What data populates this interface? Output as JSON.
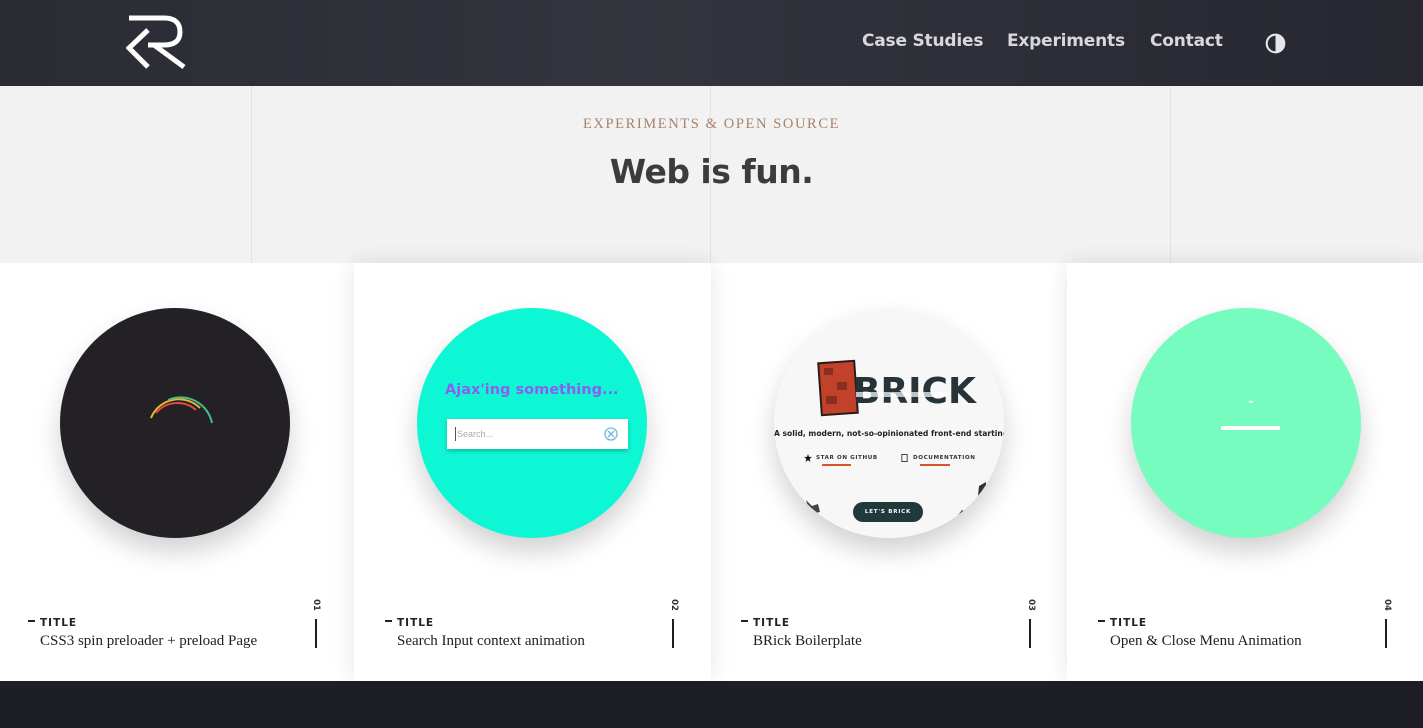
{
  "header": {
    "nav": [
      {
        "label": "Case Studies"
      },
      {
        "label": "Experiments"
      },
      {
        "label": "Contact"
      }
    ],
    "theme_toggle_icon": "contrast-icon",
    "logo_icon": "r-logo-icon"
  },
  "hero": {
    "eyebrow": "EXPERIMENTS & OPEN SOURCE",
    "title": "Web is fun."
  },
  "cards": [
    {
      "label": "TITLE",
      "name": "CSS3 spin preloader + preload Page",
      "number": "01",
      "circle_color": "#232125"
    },
    {
      "label": "TITLE",
      "name": "Search Input context animation",
      "number": "02",
      "circle_color": "#0ef7d4",
      "preview": {
        "heading": "Ajax'ing something...",
        "search_placeholder": "Search..."
      }
    },
    {
      "label": "TITLE",
      "name": "BRick Boilerplate",
      "number": "03",
      "circle_color": "#f7f7f7",
      "preview": {
        "logo_text": "BRICK",
        "description": "A solid, modern, not-so-opinionated front-end starting point.",
        "link_github": "STAR ON GITHUB",
        "link_docs": "DOCUMENTATION",
        "button": "LET'S BRICK"
      }
    },
    {
      "label": "TITLE",
      "name": "Open & Close Menu Animation",
      "number": "04",
      "circle_color": "#77fcbf"
    }
  ],
  "colors": {
    "header_bg": "#2e2f38",
    "eyebrow": "#a8826c",
    "accent_underline": "#d9552b",
    "footer_bg": "#1e1e26"
  }
}
